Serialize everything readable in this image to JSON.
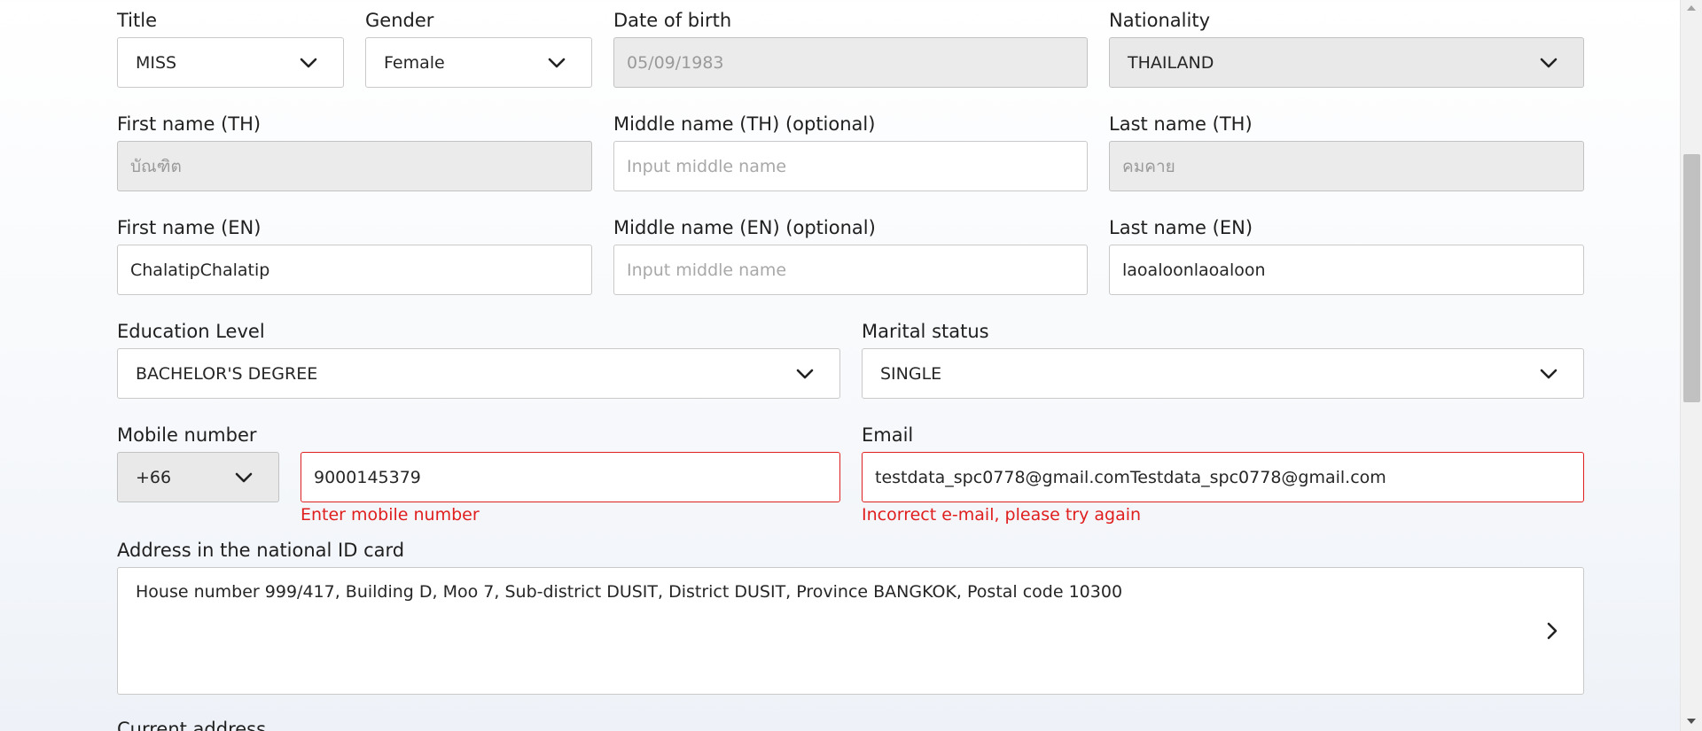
{
  "title": {
    "label": "Title",
    "value": "MISS"
  },
  "gender": {
    "label": "Gender",
    "value": "Female"
  },
  "dob": {
    "label": "Date of birth",
    "value": "05/09/1983"
  },
  "nationality": {
    "label": "Nationality",
    "value": "THAILAND"
  },
  "first_name_th": {
    "label": "First name (TH)",
    "value": "บัณฑิต"
  },
  "middle_name_th": {
    "label": "Middle name (TH) (optional)",
    "placeholder": "Input middle name"
  },
  "last_name_th": {
    "label": "Last name (TH)",
    "value": "คมคาย"
  },
  "first_name_en": {
    "label": "First name (EN)",
    "value": "ChalatipChalatip"
  },
  "middle_name_en": {
    "label": "Middle name (EN) (optional)",
    "placeholder": "Input middle name"
  },
  "last_name_en": {
    "label": "Last name (EN)",
    "value": "laoaloonlaoaloon"
  },
  "education": {
    "label": "Education Level",
    "value": "BACHELOR'S DEGREE"
  },
  "marital": {
    "label": "Marital status",
    "value": "SINGLE"
  },
  "mobile": {
    "label": "Mobile number",
    "country_code": "+66",
    "value": "9000145379",
    "error": "Enter mobile number"
  },
  "email": {
    "label": "Email",
    "value": "testdata_spc0778@gmail.comTestdata_spc0778@gmail.com",
    "error": "Incorrect e-mail, please try again"
  },
  "address_id": {
    "label": "Address in the national ID card",
    "value": "House number 999/417, Building D, Moo 7, Sub-district DUSIT, District DUSIT, Province BANGKOK, Postal code 10300"
  },
  "current_address": {
    "label": "Current address"
  },
  "colors": {
    "error": "#e01e1e",
    "border": "#c9c9c9",
    "disabled_bg": "#ebebeb"
  },
  "icons": {
    "select": "chevron-down-icon",
    "address": "chevron-right-icon"
  }
}
